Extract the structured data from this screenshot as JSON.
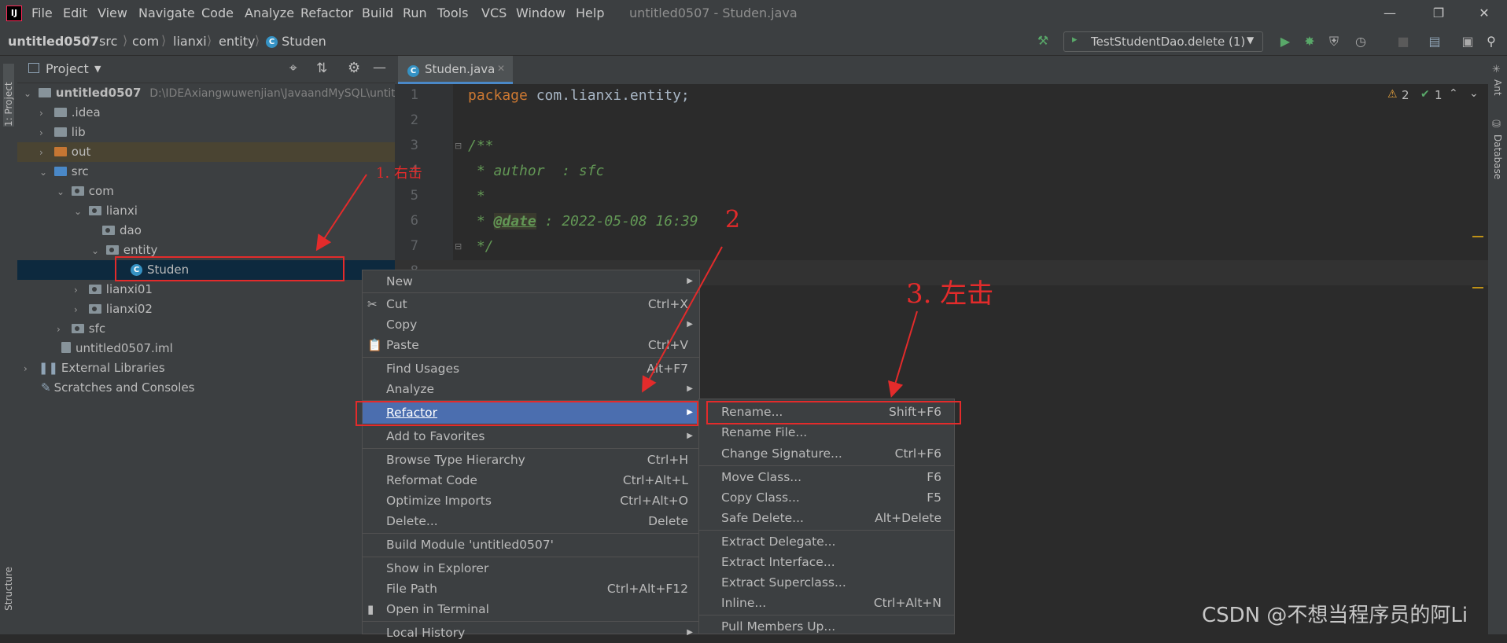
{
  "menubar": {
    "app_icon": "IJ",
    "items": [
      "File",
      "Edit",
      "View",
      "Navigate",
      "Code",
      "Analyze",
      "Refactor",
      "Build",
      "Run",
      "Tools",
      "VCS",
      "Window",
      "Help"
    ],
    "title": "untitled0507 - Studen.java"
  },
  "breadcrumb": {
    "items": [
      "untitled0507",
      "src",
      "com",
      "lianxi",
      "entity",
      "Studen"
    ]
  },
  "toolbar": {
    "run_config": "TestStudentDao.delete (1)"
  },
  "side_tabs": {
    "project": "1: Project",
    "structure": "Structure",
    "ant": "Ant",
    "database": "Database"
  },
  "project_panel": {
    "title": "Project",
    "root_name": "untitled0507",
    "root_path": "D:\\IDEAxiangwuwenjian\\JavaandMySQL\\untit",
    "tree": {
      "idea": ".idea",
      "lib": "lib",
      "out": "out",
      "src": "src",
      "com": "com",
      "lianxi": "lianxi",
      "dao": "dao",
      "entity": "entity",
      "studen": "Studen",
      "lianxi01": "lianxi01",
      "lianxi02": "lianxi02",
      "sfc": "sfc",
      "iml": "untitled0507.iml",
      "external_libraries": "External Libraries",
      "scratches": "Scratches and Consoles"
    }
  },
  "editor": {
    "tab_label": "Studen.java",
    "line_numbers": [
      "1",
      "2",
      "3",
      "4",
      "5",
      "6",
      "7",
      "8"
    ],
    "code": {
      "l1_kw": "package",
      "l1_rest": " com.lianxi.entity;",
      "l3": "/**",
      "l4": " * author  : sfc",
      "l5": " *",
      "l6_pre": " * ",
      "l6_tag": "@date",
      "l6_post": " : 2022-05-08 16:39",
      "l7": " */"
    },
    "warnings": "2",
    "checks": "1"
  },
  "context_menu": {
    "items": [
      {
        "label": "New",
        "shortcut": ""
      },
      {
        "label": "Cut",
        "shortcut": "Ctrl+X"
      },
      {
        "label": "Copy",
        "shortcut": ""
      },
      {
        "label": "Paste",
        "shortcut": "Ctrl+V"
      },
      {
        "label": "Find Usages",
        "shortcut": "Alt+F7"
      },
      {
        "label": "Analyze",
        "shortcut": ""
      },
      {
        "label": "Refactor",
        "shortcut": ""
      },
      {
        "label": "Add to Favorites",
        "shortcut": ""
      },
      {
        "label": "Browse Type Hierarchy",
        "shortcut": "Ctrl+H"
      },
      {
        "label": "Reformat Code",
        "shortcut": "Ctrl+Alt+L"
      },
      {
        "label": "Optimize Imports",
        "shortcut": "Ctrl+Alt+O"
      },
      {
        "label": "Delete...",
        "shortcut": "Delete"
      },
      {
        "label": "Build Module 'untitled0507'",
        "shortcut": ""
      },
      {
        "label": "Show in Explorer",
        "shortcut": ""
      },
      {
        "label": "File Path",
        "shortcut": "Ctrl+Alt+F12"
      },
      {
        "label": "Open in Terminal",
        "shortcut": ""
      },
      {
        "label": "Local History",
        "shortcut": ""
      }
    ]
  },
  "refactor_submenu": {
    "items": [
      {
        "label": "Rename...",
        "shortcut": "Shift+F6"
      },
      {
        "label": "Rename File...",
        "shortcut": ""
      },
      {
        "label": "Change Signature...",
        "shortcut": "Ctrl+F6"
      },
      {
        "label": "Move Class...",
        "shortcut": "F6"
      },
      {
        "label": "Copy Class...",
        "shortcut": "F5"
      },
      {
        "label": "Safe Delete...",
        "shortcut": "Alt+Delete"
      },
      {
        "label": "Extract Delegate...",
        "shortcut": ""
      },
      {
        "label": "Extract Interface...",
        "shortcut": ""
      },
      {
        "label": "Extract Superclass...",
        "shortcut": ""
      },
      {
        "label": "Inline...",
        "shortcut": "Ctrl+Alt+N"
      },
      {
        "label": "Pull Members Up...",
        "shortcut": ""
      }
    ]
  },
  "annotations": {
    "step1": "1. 右击",
    "step2": "2",
    "step3": "3. 左击"
  },
  "watermark": "CSDN @不想当程序员的阿Li",
  "colors": {
    "accent": "#4b6eaf",
    "annotation": "#e32b2b",
    "selection": "#0d293e"
  }
}
